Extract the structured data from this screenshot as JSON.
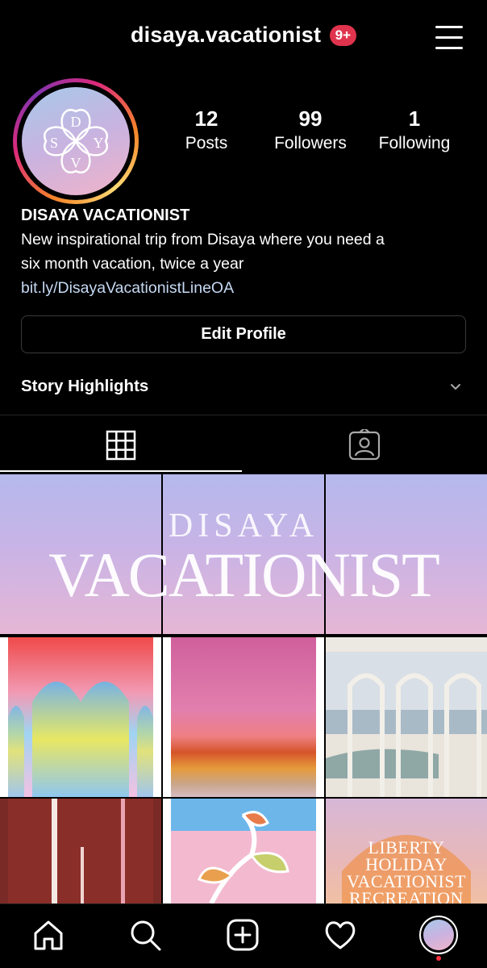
{
  "header": {
    "username": "disaya.vacationist",
    "notification_badge": "9+",
    "menu_icon": "hamburger-menu-icon"
  },
  "profile": {
    "avatar_letters": [
      "D",
      "S",
      "Y",
      "V"
    ],
    "stats": [
      {
        "value": "12",
        "label": "Posts"
      },
      {
        "value": "99",
        "label": "Followers"
      },
      {
        "value": "1",
        "label": "Following"
      }
    ],
    "bio": {
      "name": "DISAYA VACATIONIST",
      "lines": [
        "New inspirational trip from Disaya where you need a",
        "six month vacation, twice a year"
      ],
      "link": "bit.ly/DisayaVacationistLineOA"
    },
    "edit_button": "Edit Profile",
    "highlights_label": "Story Highlights"
  },
  "tabs": [
    {
      "icon": "grid-icon",
      "active": true
    },
    {
      "icon": "tagged-person-icon",
      "active": false
    }
  ],
  "grid": {
    "banner_line1": "DISAYA",
    "banner_line2": "VACATIONIST",
    "liberty_lines": [
      "LIBERTY",
      "HOLIDAY",
      "VACATIONIST",
      "RECREATION"
    ]
  },
  "bottom_nav": [
    {
      "icon": "home-icon"
    },
    {
      "icon": "search-icon"
    },
    {
      "icon": "new-post-icon"
    },
    {
      "icon": "heart-icon"
    },
    {
      "icon": "profile-avatar-icon"
    }
  ],
  "colors": {
    "badge": "#e0334d",
    "link": "#c5d9f3",
    "background": "#000000"
  }
}
